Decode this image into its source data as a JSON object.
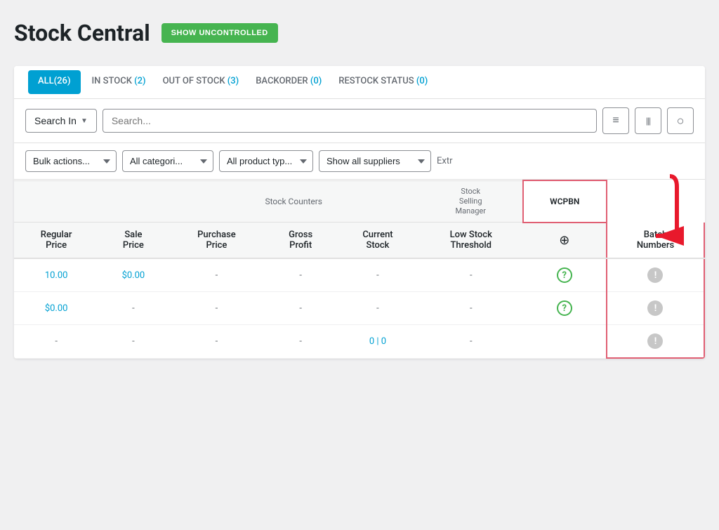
{
  "page": {
    "title": "Stock Central",
    "show_uncontrolled_label": "SHOW UNCONTROLLED"
  },
  "tabs": [
    {
      "id": "all",
      "label": "ALL",
      "count": "(26)",
      "active": true
    },
    {
      "id": "in_stock",
      "label": "IN STOCK",
      "count": "(2)",
      "active": false
    },
    {
      "id": "out_of_stock",
      "label": "OUT OF STOCK",
      "count": "(3)",
      "active": false
    },
    {
      "id": "backorder",
      "label": "BACKORDER",
      "count": "(0)",
      "active": false
    },
    {
      "id": "restock_status",
      "label": "RESTOCK STATUS",
      "count": "(0)",
      "active": false
    }
  ],
  "search": {
    "search_in_label": "Search In",
    "placeholder": "Search...",
    "list_icon": "≡",
    "barcode_icon": "|||",
    "settings_icon": "○"
  },
  "filters": {
    "bulk_actions_label": "Bulk actions...",
    "all_categories_label": "All categori...",
    "all_product_types_label": "All product typ...",
    "show_all_suppliers_label": "Show all suppliers"
  },
  "table": {
    "group_headers": [
      {
        "label": "",
        "colspan": 2,
        "type": "empty"
      },
      {
        "label": "Stock Counters",
        "colspan": 3,
        "type": "normal"
      },
      {
        "label": "Stock\nSelling\nManager",
        "colspan": 1,
        "type": "normal"
      },
      {
        "label": "WCPBN",
        "colspan": 1,
        "type": "wcpbn"
      }
    ],
    "col_headers": [
      {
        "label": "Regular\nPrice"
      },
      {
        "label": "Sale\nPrice"
      },
      {
        "label": "Purchase\nPrice"
      },
      {
        "label": "Gross\nProfit"
      },
      {
        "label": "Current\nStock"
      },
      {
        "label": "Low Stock\nThreshold"
      },
      {
        "label": "⊕",
        "is_icon": true
      },
      {
        "label": "Batch\nNumbers",
        "type": "wcpbn"
      }
    ],
    "rows": [
      {
        "regular_price": "10.00",
        "sale_price": "$0.00",
        "purchase_price": "-",
        "gross_profit": "-",
        "current_stock": "-",
        "low_stock_threshold": "-",
        "ssm_icon": "question",
        "batch_numbers": "info"
      },
      {
        "regular_price": "$0.00",
        "sale_price": "-",
        "purchase_price": "-",
        "gross_profit": "-",
        "current_stock": "-",
        "low_stock_threshold": "-",
        "ssm_icon": "question",
        "batch_numbers": "info"
      },
      {
        "regular_price": "-",
        "sale_price": "-",
        "purchase_price": "-",
        "gross_profit": "-",
        "current_stock": "0 | 0",
        "low_stock_threshold": "-",
        "ssm_icon": "none",
        "batch_numbers": "info"
      }
    ]
  }
}
